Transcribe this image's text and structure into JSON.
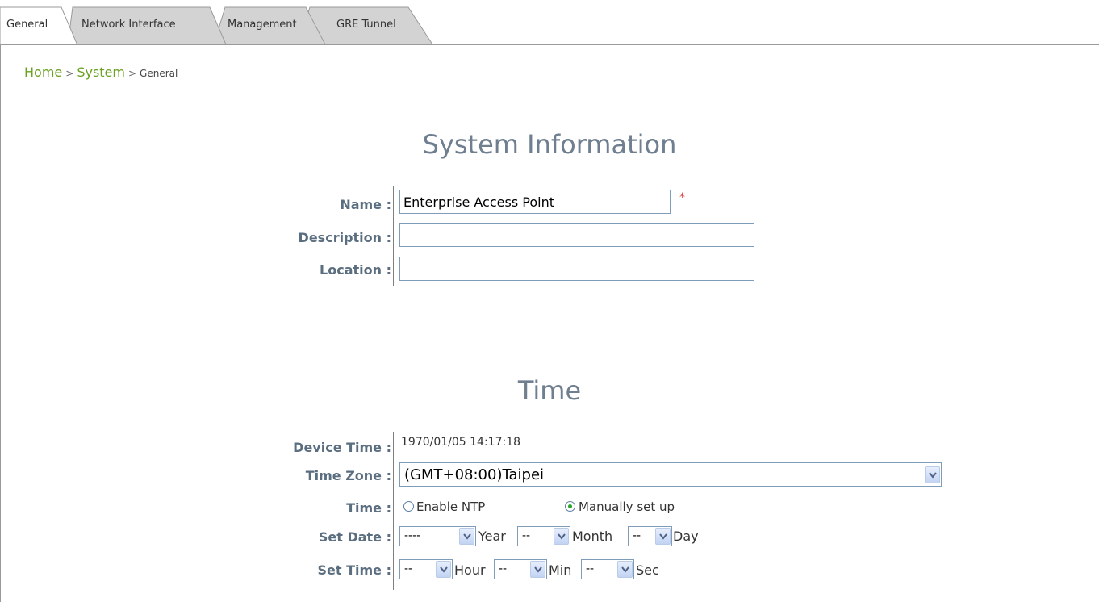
{
  "tabs": [
    {
      "label": "General",
      "active": true
    },
    {
      "label": "Network Interface",
      "active": false
    },
    {
      "label": "Management",
      "active": false
    },
    {
      "label": "GRE Tunnel",
      "active": false
    }
  ],
  "breadcrumb": {
    "home": "Home",
    "separator": ">",
    "system": "System",
    "current": "General"
  },
  "system_info": {
    "title": "System Information",
    "name_label": "Name :",
    "name_value": "Enterprise Access Point",
    "required_mark": "*",
    "description_label": "Description :",
    "description_value": "",
    "location_label": "Location :",
    "location_value": ""
  },
  "time": {
    "title": "Time",
    "device_time_label": "Device Time :",
    "device_time_value": "1970/01/05 14:17:18",
    "time_zone_label": "Time Zone :",
    "time_zone_value": "(GMT+08:00)Taipei",
    "time_label": "Time :",
    "enable_ntp_label": "Enable NTP",
    "enable_ntp_selected": false,
    "manual_label": "Manually set up",
    "manual_selected": true,
    "set_date_label": "Set Date :",
    "year_value": "----",
    "year_unit": "Year",
    "month_value": "--",
    "month_unit": "Month",
    "day_value": "--",
    "day_unit": "Day",
    "set_time_label": "Set Time :",
    "hour_value": "--",
    "hour_unit": "Hour",
    "min_value": "--",
    "min_unit": "Min",
    "sec_value": "--",
    "sec_unit": "Sec"
  },
  "colors": {
    "link_green": "#6aa121",
    "label_blue": "#5a6e80",
    "title_gray": "#6f7f8f",
    "required_red": "#e23c3c",
    "radio_green": "#27a327"
  },
  "icons": [
    "chevron-down-icon",
    "radio-icon"
  ]
}
